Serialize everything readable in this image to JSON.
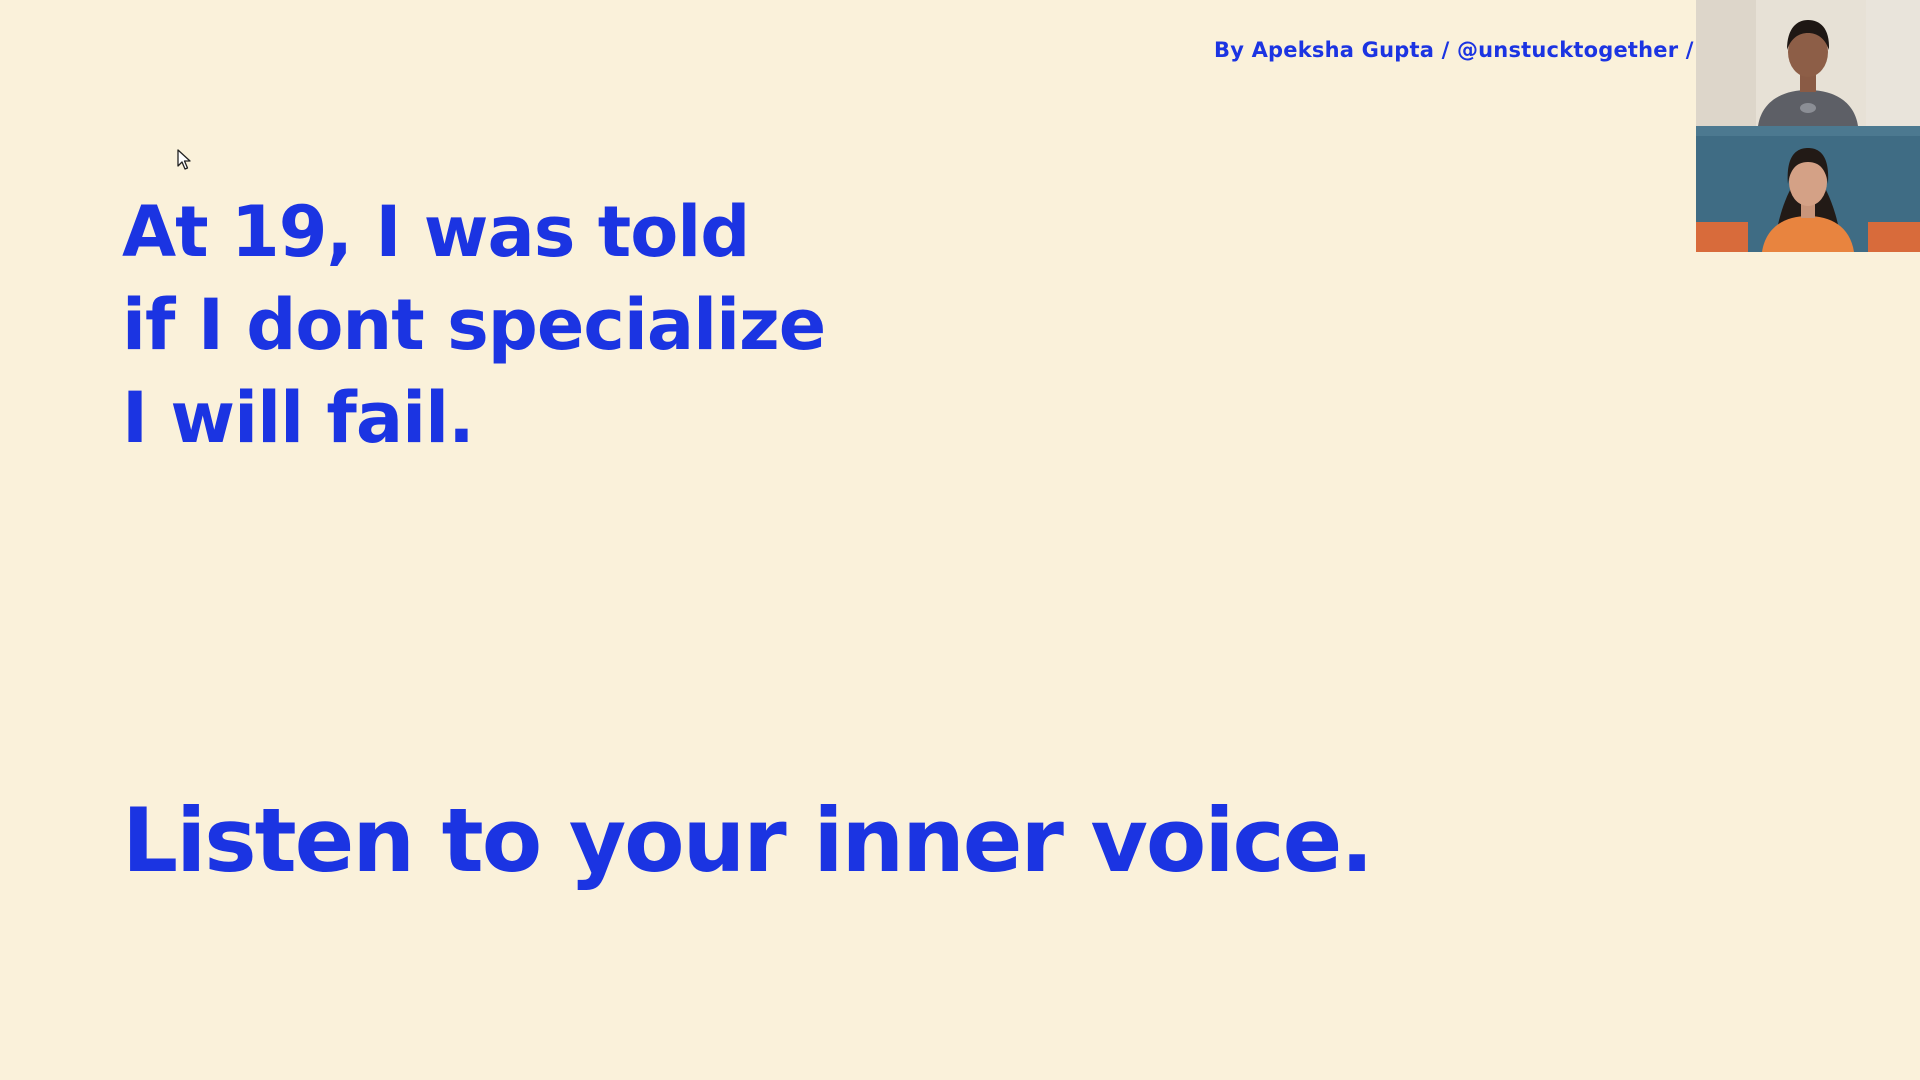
{
  "slide": {
    "byline": "By Apeksha Gupta / @unstucktogether / @",
    "headline_lines": [
      "At 19, I was told",
      "if I dont specialize",
      "I will fail."
    ],
    "statement": "Listen to your inner voice."
  },
  "colors": {
    "background": "#faf1da",
    "text_accent": "#1b34e2"
  },
  "video_panel": {
    "tiles": [
      {
        "icon": "participant-video"
      },
      {
        "icon": "participant-video"
      }
    ]
  }
}
